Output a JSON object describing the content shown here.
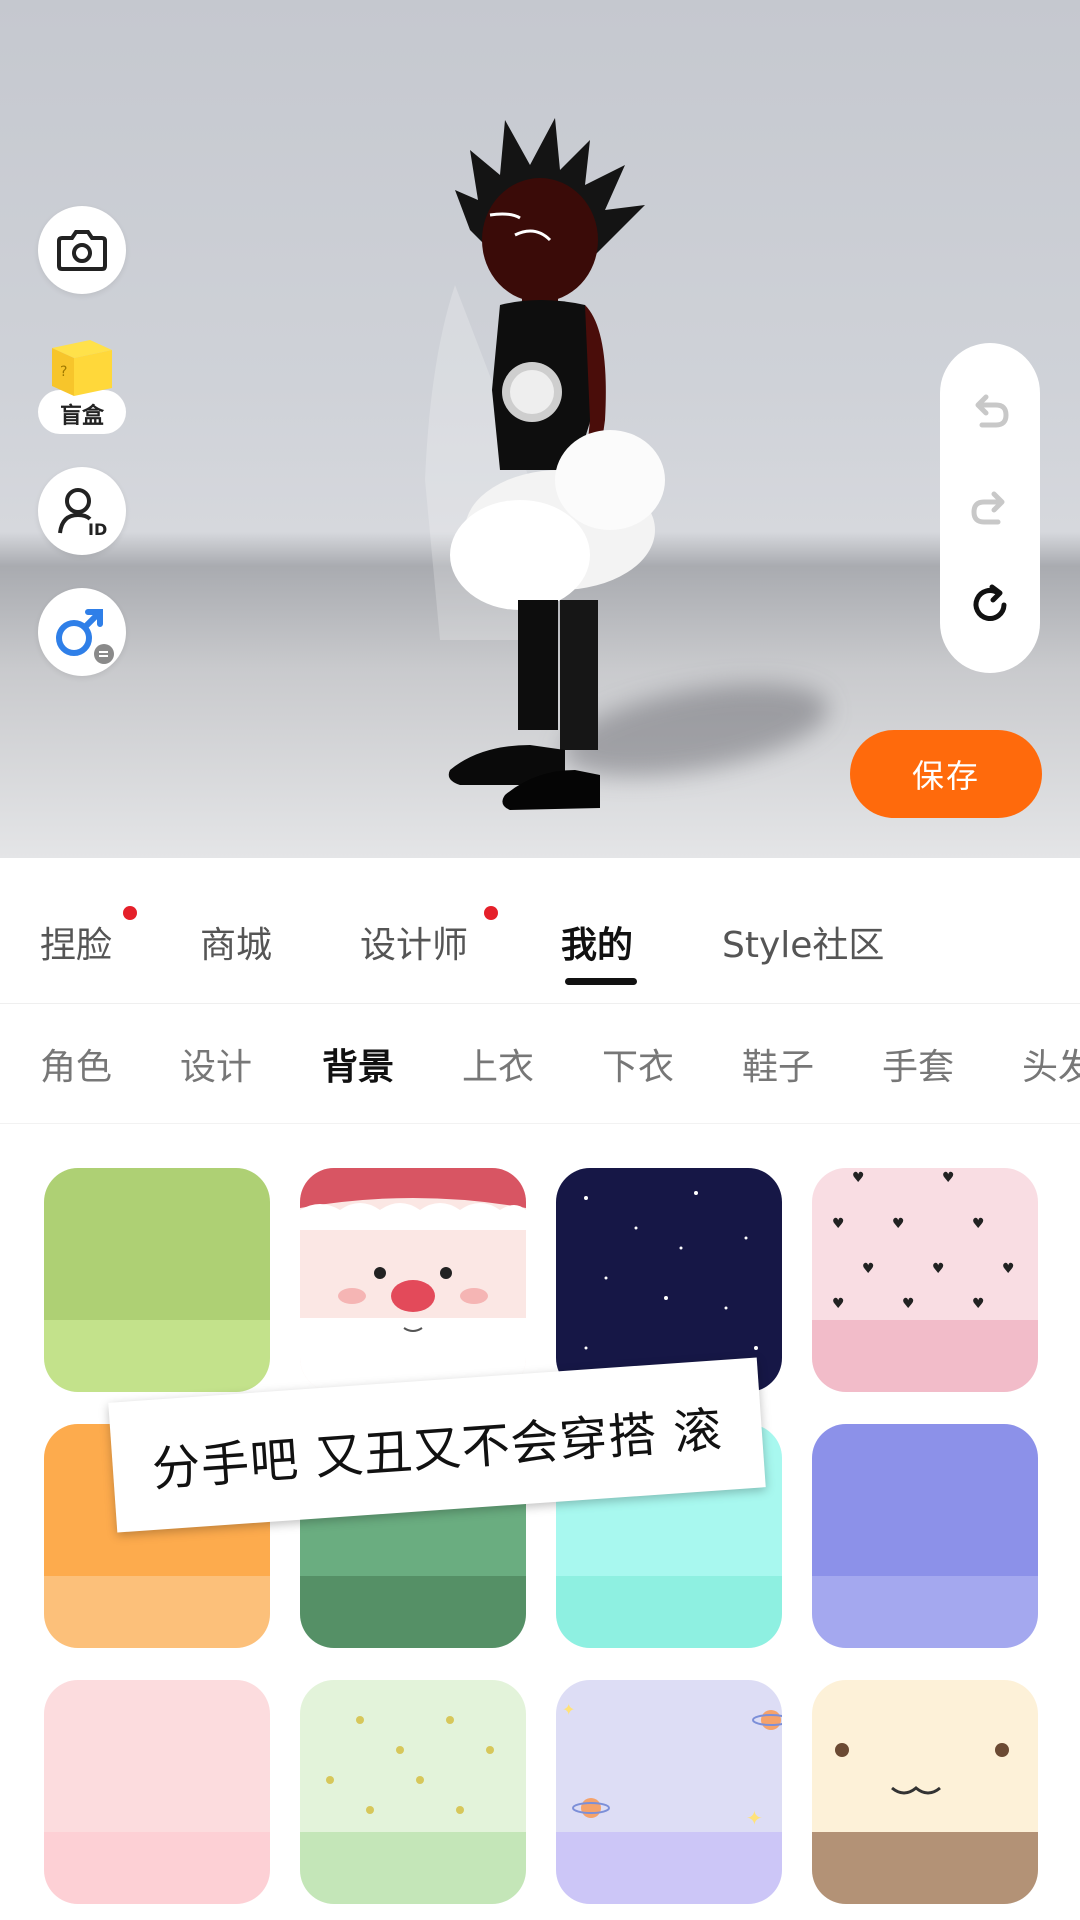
{
  "viewport": {
    "left_buttons": [
      {
        "name": "camera-icon"
      },
      {
        "name": "blind-box-icon",
        "label": "盲盒"
      },
      {
        "name": "avatar-id-icon"
      },
      {
        "name": "gender-switch-icon"
      }
    ],
    "history": {
      "undo": "undo-icon",
      "redo": "redo-icon",
      "reset": "reset-icon"
    },
    "save_label": "保存"
  },
  "main_tabs": [
    {
      "label": "捏脸",
      "badge": true
    },
    {
      "label": "商城",
      "badge": false
    },
    {
      "label": "设计师",
      "badge": true
    },
    {
      "label": "我的",
      "badge": false,
      "active": true
    },
    {
      "label": "Style社区",
      "badge": false
    }
  ],
  "sub_tabs": [
    {
      "label": "角色"
    },
    {
      "label": "设计"
    },
    {
      "label": "背景",
      "active": true
    },
    {
      "label": "上衣"
    },
    {
      "label": "下衣"
    },
    {
      "label": "鞋子"
    },
    {
      "label": "手套"
    },
    {
      "label": "头发"
    }
  ],
  "backgrounds": [
    {
      "name": "green-background",
      "top": "#aed074",
      "bottom": "#c3e28b"
    },
    {
      "name": "santa-background",
      "top": "#fbe7e4",
      "bottom": "#ffffff"
    },
    {
      "name": "starry-night-background",
      "top": "#161746",
      "bottom": "#161746"
    },
    {
      "name": "pink-hearts-background",
      "top": "#f9dde3",
      "bottom": "#f2bcc9"
    },
    {
      "name": "orange-background",
      "top": "#fdab4d",
      "bottom": "#fcc07a"
    },
    {
      "name": "green-snowflake-background",
      "top": "#6aad80",
      "bottom": "#559066"
    },
    {
      "name": "aqua-background",
      "top": "#a8f8ef",
      "bottom": "#8ef0e1"
    },
    {
      "name": "periwinkle-background",
      "top": "#8c91e9",
      "bottom": "#a4a8ef"
    },
    {
      "name": "blush-pink-background",
      "top": "#fcdcde",
      "bottom": "#fdd0d5"
    },
    {
      "name": "mint-flower-background",
      "top": "#e3f3da",
      "bottom": "#c4e6b8"
    },
    {
      "name": "lavender-planet-background",
      "top": "#ddddf5",
      "bottom": "#ccc6f7"
    },
    {
      "name": "cream-face-background",
      "top": "#fdf1d8",
      "bottom": "#b39276"
    }
  ],
  "overlay_caption": "分手吧 又丑又不会穿搭 滚",
  "colors": {
    "accent": "#ff6a0c",
    "badge": "#e5202a"
  }
}
